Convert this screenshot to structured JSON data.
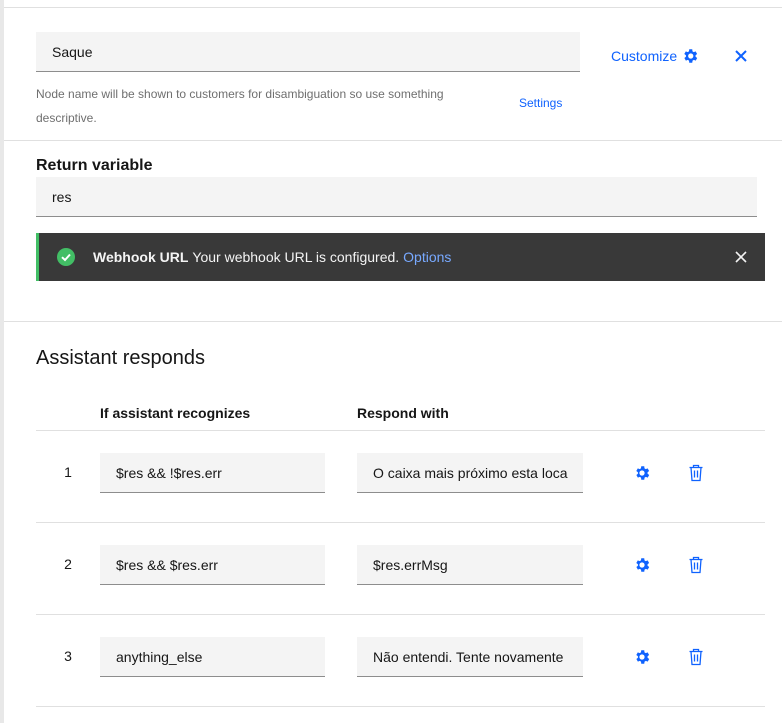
{
  "node": {
    "name_value": "Saque",
    "helper_text": "Node name will be shown to customers for disambiguation so use something descriptive.",
    "settings_label": "Settings",
    "customize_label": "Customize"
  },
  "return_variable": {
    "label": "Return variable",
    "value": "res"
  },
  "webhook_toast": {
    "title": "Webhook URL",
    "message": "Your webhook URL is configured.",
    "link": "Options"
  },
  "responds": {
    "title": "Assistant responds",
    "headers": {
      "condition": "If assistant recognizes",
      "response": "Respond with"
    },
    "rows": [
      {
        "num": "1",
        "condition": "$res && !$res.err",
        "response": "O caixa mais próximo esta loca"
      },
      {
        "num": "2",
        "condition": "$res && $res.err",
        "response": "$res.errMsg"
      },
      {
        "num": "3",
        "condition": "anything_else",
        "response": "Não entendi. Tente novamente"
      }
    ]
  },
  "colors": {
    "accent": "#0f62fe",
    "toast_bg": "#393939",
    "success": "#42be65",
    "toast_link": "#78a9ff"
  }
}
